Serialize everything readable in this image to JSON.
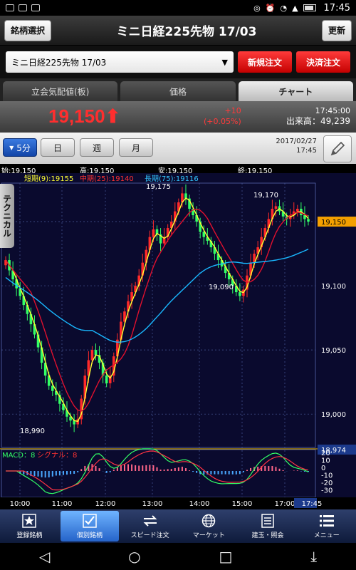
{
  "status": {
    "time": "17:45"
  },
  "header": {
    "left_button": "銘柄選択",
    "title": "ミニ日経225先物 17/03",
    "right_button": "更新"
  },
  "symbol": {
    "selected": "ミニ日経225先物 17/03",
    "new_order": "新規注文",
    "settle_order": "決済注文"
  },
  "tabs": [
    {
      "label": "立会気配値(板)"
    },
    {
      "label": "価格"
    },
    {
      "label": "チャート"
    }
  ],
  "quote": {
    "price": "19,150",
    "arrow": "⬆",
    "change": "+10",
    "change_pct": "(+0.05%)",
    "time": "17:45:00",
    "volume_label": "出来高：49,239"
  },
  "intervals": {
    "selected": "5分",
    "day": "日",
    "week": "週",
    "month": "月",
    "date": "2017/02/27",
    "time": "17:45"
  },
  "ohlc": {
    "open": "始:19,150",
    "high": "高:19,150",
    "low": "安:19,150",
    "close": "終:19,150"
  },
  "technical_tab": "テクニカル",
  "legend": {
    "short": "短期(9):19155",
    "mid": "中期(25):19140",
    "long": "長期(75):19116"
  },
  "macd_legend": {
    "macd": "MACD：8",
    "signal": "シグナル：8"
  },
  "colors": {
    "up": "#ff2a2a",
    "down": "#33ff66",
    "short_ma": "#ffff33",
    "mid_ma": "#e0102e",
    "long_ma": "#19b8ff",
    "background": "#0a0a2e"
  },
  "chart_data": {
    "type": "candlestick",
    "price_axis": {
      "min": 18974,
      "max": 19180,
      "ticks": [
        "19,150",
        "19,100",
        "19,050",
        "19,000",
        "18,974"
      ]
    },
    "time_axis": [
      "10:00",
      "11:00",
      "12:00",
      "13:00",
      "14:00",
      "15:00",
      "17:00",
      "17:45"
    ],
    "annotations": [
      "19,175",
      "19,170",
      "19,090",
      "18,990"
    ],
    "current_label": "19,150",
    "macd_axis": [
      "20",
      "10",
      "0",
      "-10",
      "-20",
      "-30"
    ],
    "closes": [
      19120,
      19112,
      19105,
      19098,
      19092,
      19085,
      19078,
      19070,
      19062,
      19052,
      19040,
      19030,
      19022,
      19018,
      19015,
      19008,
      19003,
      18998,
      18995,
      18992,
      18996,
      19012,
      19030,
      19042,
      19050,
      19046,
      19040,
      19030,
      19024,
      19030,
      19045,
      19058,
      19072,
      19080,
      19088,
      19095,
      19100,
      19108,
      19118,
      19128,
      19138,
      19144,
      19140,
      19133,
      19138,
      19145,
      19150,
      19158,
      19165,
      19172,
      19168,
      19160,
      19155,
      19150,
      19142,
      19138,
      19135,
      19130,
      19125,
      19120,
      19115,
      19110,
      19105,
      19100,
      19095,
      19092,
      19097,
      19108,
      19118,
      19125,
      19130,
      19138,
      19145,
      19152,
      19160,
      19162,
      19158,
      19154,
      19152,
      19155,
      19158,
      19160,
      19155,
      19152,
      19150
    ]
  },
  "bottom_nav": [
    {
      "label": "登録銘柄",
      "icon": "star-icon"
    },
    {
      "label": "個別銘柄",
      "icon": "check-icon"
    },
    {
      "label": "スピード注文",
      "icon": "arrows-icon"
    },
    {
      "label": "マーケット",
      "icon": "globe-icon"
    },
    {
      "label": "建玉・照会",
      "icon": "list-icon"
    },
    {
      "label": "メニュー",
      "icon": "menu-icon"
    }
  ]
}
